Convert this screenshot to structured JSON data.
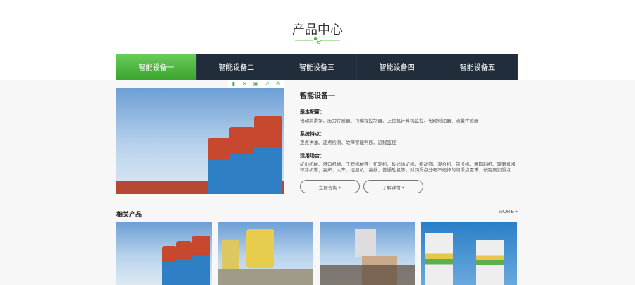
{
  "page_title": "产品中心",
  "tabs": [
    "智能设备一",
    "智能设备二",
    "智能设备三",
    "智能设备四",
    "智能设备五"
  ],
  "toolbar_icons": [
    "bookmark-icon",
    "close-icon",
    "save-icon",
    "share-icon",
    "settings-icon"
  ],
  "product": {
    "name": "智能设备一",
    "sections": [
      {
        "heading": "基本配置：",
        "text": "电动润滑泵、压力传感器、可编程控制器、上位机计算机监控、电磁给油器、流量传感器"
      },
      {
        "heading": "系统特点：",
        "text": "逐点供油、逐点检测、故障智能判断、远程监控"
      },
      {
        "heading": "适用场合：",
        "text": "矿山机械、港口机械、工程机械等：如轮机、板式给矿机、振动筛、混合机、带冷机、堆取料机、辊磨机和环冷机等；高炉：大车、挖掘机、高线、普通轧机等；对润滑点分布不规律的润滑点需求；长距离润滑点"
      }
    ],
    "consult_label": "立即咨询 +",
    "details_label": "了解详情 +"
  },
  "related": {
    "title": "相关产品",
    "more": "MORE +"
  },
  "colors": {
    "accent": "#4caf3f",
    "nav": "#212d3b"
  }
}
